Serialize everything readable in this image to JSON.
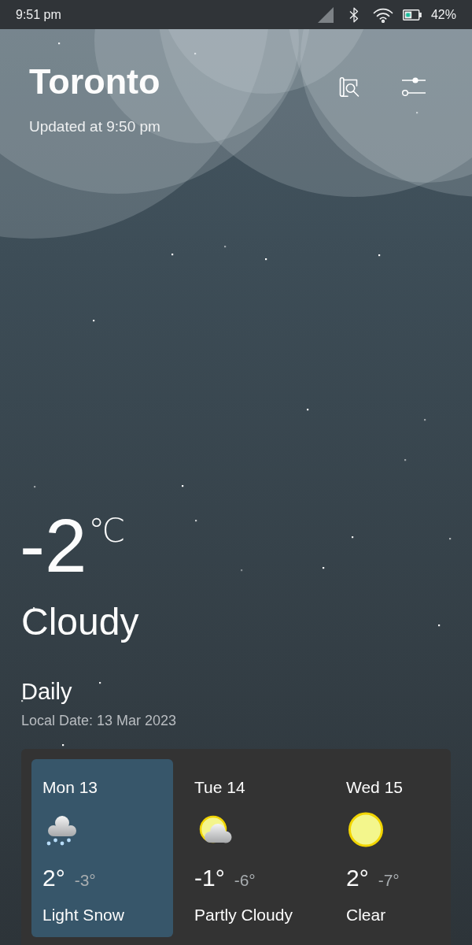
{
  "status_bar": {
    "time": "9:51 pm",
    "battery": "42%"
  },
  "header": {
    "city": "Toronto",
    "updated": "Updated at 9:50 pm"
  },
  "current": {
    "temperature": "-2",
    "unit": "℃",
    "condition": "Cloudy"
  },
  "daily": {
    "title": "Daily",
    "local_date": "Local Date: 13 Mar 2023",
    "days": [
      {
        "day": "Mon 13",
        "kind": "snow",
        "high": "2°",
        "low": "-3°",
        "condition": "Light Snow",
        "selected": true
      },
      {
        "day": "Tue 14",
        "kind": "partly_cloudy",
        "high": "-1°",
        "low": "-6°",
        "condition": "Partly Cloudy",
        "selected": false
      },
      {
        "day": "Wed 15",
        "kind": "clear",
        "high": "2°",
        "low": "-7°",
        "condition": "Clear",
        "selected": false
      }
    ]
  }
}
